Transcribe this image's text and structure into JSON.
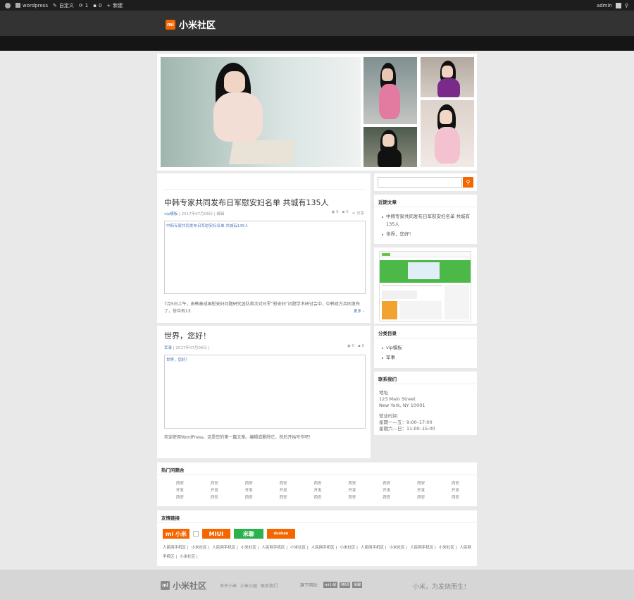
{
  "adminbar": {
    "site": "wordpress",
    "customize": "自定义",
    "updates": "1",
    "comments": "0",
    "new": "新建",
    "user": "admin"
  },
  "header": {
    "logo_mark": "mi",
    "brand": "小米社区"
  },
  "posts": [
    {
      "title": "中韩专家共同发布日军慰安妇名单 共城有135人",
      "category": "vip模板",
      "date": "2017年07月08日",
      "meta_sep": "|",
      "tag": "编辑",
      "views": "0",
      "comments": "0",
      "share": "分享",
      "embed_text": "中韩专家共同发布日军慰安妇名单 共城有135人",
      "excerpt": "7月5日上午，由韩泰成国慰安妇问题研究团队首次对日军“慰安妇”问题学术研讨会中，中韩双方共同发布了，份共有13",
      "more": "更多 ›"
    },
    {
      "title": "世界，您好！",
      "category": "军事",
      "date": "2017年07月06日",
      "meta_sep": "|",
      "views": "0",
      "comments": "0",
      "embed_text": "世界，您好！",
      "excerpt": "欢迎使用WordPress。这是您的第一篇文章。编辑或删除它，然后开始写作吧！"
    }
  ],
  "sidebar": {
    "search_placeholder": "",
    "recent_title": "近期文章",
    "recent": [
      "中韩专家共同发布日军慰安妇名单 共城有135人",
      "世界，您好！"
    ],
    "categories_title": "分类目录",
    "categories": [
      "vip模板",
      "军事"
    ],
    "contact_title": "联系我们",
    "contact_lines": [
      "地址",
      "123 Main Street",
      "New York, NY 10001",
      "",
      "营业时间",
      "星期一—五：9:00–17:00",
      "星期六—日：11:00–15:00"
    ]
  },
  "hot": {
    "title": "热门问题合",
    "cells": [
      "西安",
      "西安",
      "西安",
      "西安",
      "西安",
      "西安",
      "西安",
      "西安",
      "西安",
      "开发",
      "开发",
      "开发",
      "开发",
      "开发",
      "开发",
      "开发",
      "开发",
      "开发",
      "西安",
      "西安",
      "西安",
      "西安",
      "西安",
      "西安",
      "西安",
      "西安",
      "西安"
    ]
  },
  "links": {
    "title": "友情链接",
    "logos": [
      "mi 小米",
      "MIUI",
      "米聊",
      "duokan"
    ],
    "logo_colors": [
      "#f56600",
      "#f56600",
      "#2bb24c",
      "#f56600"
    ],
    "items": [
      "人民网手机区",
      "小米社区",
      "人民网手机区",
      "小米社区",
      "人民网手机区",
      "小米社区",
      "人民网手机区",
      "小米社区",
      "人民网手机区",
      "小米社区",
      "人民网手机区",
      "小米社区",
      "人民网手机区",
      "小米社区"
    ]
  },
  "footer": {
    "logo_mark": "mi",
    "brand": "小米社区",
    "nav": [
      "关于小米",
      "小米公园",
      "联系我们"
    ],
    "download_label": "旗下网站：",
    "download_badges": [
      "mi小米",
      "MIUI",
      "米聊"
    ],
    "slogan": "小米，为发烧而生！"
  },
  "colors": {
    "accent": "#f56600",
    "link": "#4a77b9"
  }
}
